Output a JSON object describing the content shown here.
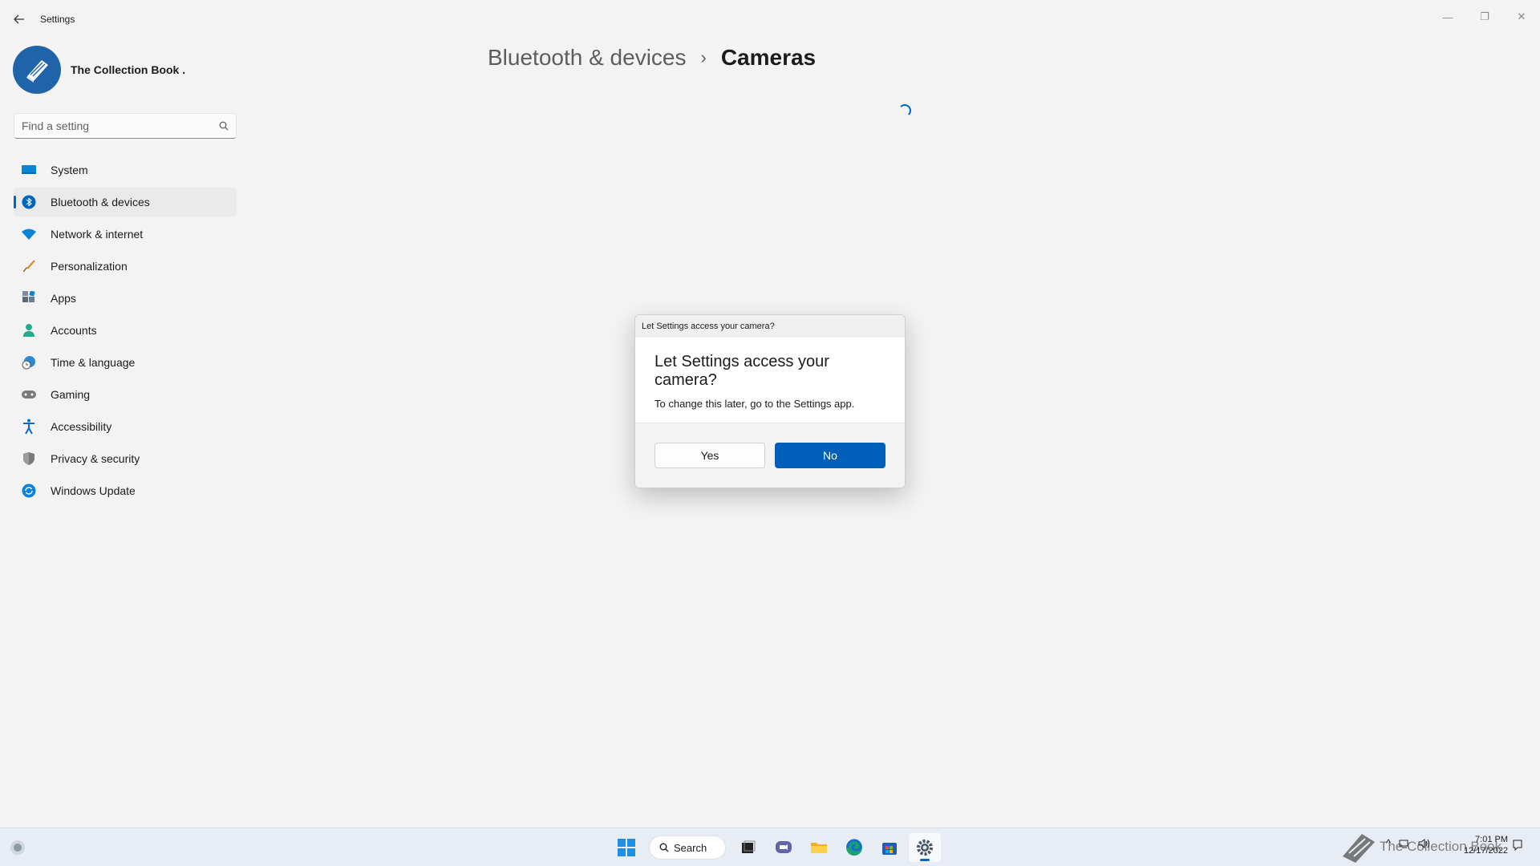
{
  "window": {
    "title": "Settings",
    "controls": {
      "minimize": "—",
      "maximize": "❐",
      "close": "✕"
    }
  },
  "profile": {
    "name": "The Collection Book ."
  },
  "search": {
    "placeholder": "Find a setting"
  },
  "nav": {
    "items": [
      {
        "label": "System",
        "icon": "monitor-icon",
        "color": "#0a84d6"
      },
      {
        "label": "Bluetooth & devices",
        "icon": "bluetooth-icon",
        "color": "#0067c0",
        "active": true
      },
      {
        "label": "Network & internet",
        "icon": "wifi-icon",
        "color": "#0a84d6"
      },
      {
        "label": "Personalization",
        "icon": "brush-icon",
        "color": "#e08a2e"
      },
      {
        "label": "Apps",
        "icon": "apps-icon",
        "color": "#5c6b7a"
      },
      {
        "label": "Accounts",
        "icon": "person-icon",
        "color": "#1fae8b"
      },
      {
        "label": "Time & language",
        "icon": "globe-clock-icon",
        "color": "#2a8ad4"
      },
      {
        "label": "Gaming",
        "icon": "gamepad-icon",
        "color": "#7a7a7a"
      },
      {
        "label": "Accessibility",
        "icon": "accessibility-icon",
        "color": "#0a6cc9"
      },
      {
        "label": "Privacy & security",
        "icon": "shield-icon",
        "color": "#7a7a7a"
      },
      {
        "label": "Windows Update",
        "icon": "update-icon",
        "color": "#0a84d6"
      }
    ]
  },
  "breadcrumb": {
    "parent": "Bluetooth & devices",
    "separator": "›",
    "current": "Cameras"
  },
  "dialog": {
    "title_bar": "Let Settings access your camera?",
    "heading": "Let Settings access your camera?",
    "message": "To change this later, go to the Settings app.",
    "yes_label": "Yes",
    "no_label": "No"
  },
  "taskbar": {
    "search_label": "Search",
    "watermark": "The Collection Book",
    "time": "7:01 PM",
    "date": "12/17/2022"
  },
  "colors": {
    "accent": "#005fb8",
    "background": "#f3f3f3"
  }
}
